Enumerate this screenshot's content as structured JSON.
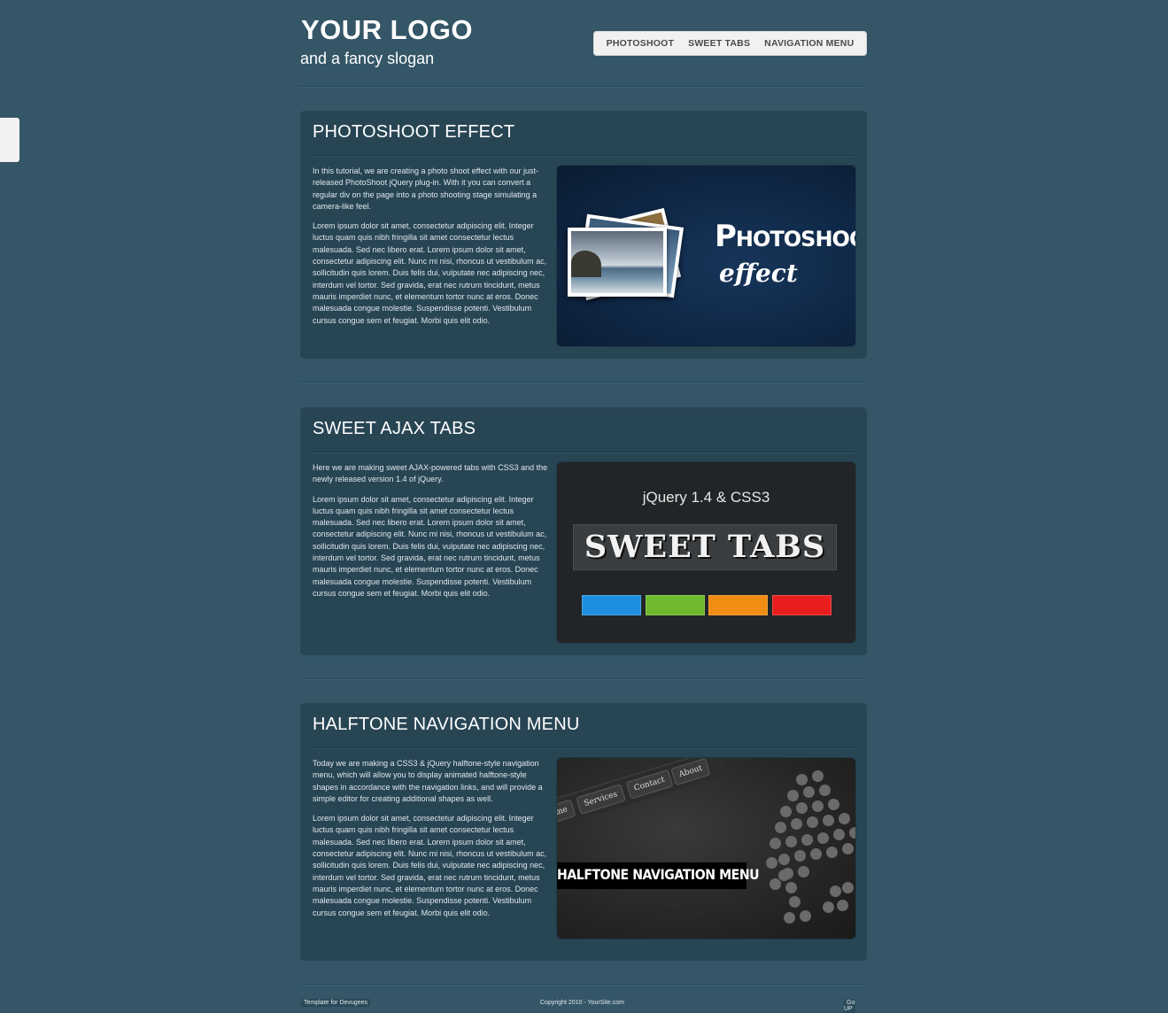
{
  "header": {
    "logo": "YOUR LOGO",
    "slogan": "and a fancy slogan"
  },
  "nav": {
    "items": [
      "PHOTOSHOOT",
      "SWEET TABS",
      "NAVIGATION MENU"
    ]
  },
  "sections": [
    {
      "title": "PHOTOSHOOT EFFECT",
      "intro": "In this tutorial, we are creating a photo shoot effect with our just-released PhotoShoot jQuery plug-in. With it you can convert a regular div on the page into a photo shooting stage simulating a camera-like feel.",
      "body": "Lorem ipsum dolor sit amet, consectetur adipiscing elit. Integer luctus quam quis nibh fringilla sit amet consectetur lectus malesuada. Sed nec libero erat. Lorem ipsum dolor sit amet, consectetur adipiscing elit. Nunc mi nisi, rhoncus ut vestibulum ac, sollicitudin quis lorem. Duis felis dui, vulputate nec adipiscing nec, interdum vel tortor. Sed gravida, erat nec rutrum tincidunt, metus mauris imperdiet nunc, et elementum tortor nunc at eros. Donec malesuada congue molestie. Suspendisse potenti. Vestibulum cursus congue sem et feugiat. Morbi quis elit odio.",
      "image": {
        "title": "Photoshoot",
        "subtitle": "effect"
      }
    },
    {
      "title": "SWEET AJAX TABS",
      "intro": "Here we are making sweet AJAX-powered tabs with CSS3 and the newly released version 1.4 of jQuery.",
      "body": "Lorem ipsum dolor sit amet, consectetur adipiscing elit. Integer luctus quam quis nibh fringilla sit amet consectetur lectus malesuada. Sed nec libero erat. Lorem ipsum dolor sit amet, consectetur adipiscing elit. Nunc mi nisi, rhoncus ut vestibulum ac, sollicitudin quis lorem. Duis felis dui, vulputate nec adipiscing nec, interdum vel tortor. Sed gravida, erat nec rutrum tincidunt, metus mauris imperdiet nunc, et elementum tortor nunc at eros. Donec malesuada congue molestie. Suspendisse potenti. Vestibulum cursus congue sem et feugiat. Morbi quis elit odio.",
      "image": {
        "caption": "jQuery 1.4 & CSS3",
        "title": "SWEET TABS",
        "swatches": [
          "#1e8fe0",
          "#6fba2c",
          "#f08d12",
          "#e81e1e"
        ]
      }
    },
    {
      "title": "HALFTONE NAVIGATION MENU",
      "intro": "Today we are making a CSS3 & jQuery halftone-style navigation menu, which will allow you to display animated halftone-style shapes in accordance with the navigation links, and will provide a simple editor for creating additional shapes as well.",
      "body": "Lorem ipsum dolor sit amet, consectetur adipiscing elit. Integer luctus quam quis nibh fringilla sit amet consectetur lectus malesuada. Sed nec libero erat. Lorem ipsum dolor sit amet, consectetur adipiscing elit. Nunc mi nisi, rhoncus ut vestibulum ac, sollicitudin quis lorem. Duis felis dui, vulputate nec adipiscing nec, interdum vel tortor. Sed gravida, erat nec rutrum tincidunt, metus mauris imperdiet nunc, et elementum tortor nunc at eros. Donec malesuada congue molestie. Suspendisse potenti. Vestibulum cursus congue sem et feugiat. Morbi quis elit odio.",
      "image": {
        "title": "HALFTONE NAVIGATION MENU",
        "menu": [
          "me",
          "Services",
          "Contact",
          "About"
        ]
      }
    }
  ],
  "footer": {
    "left": "Template for Devugees",
    "center": "Copyright 2010 - YourSite.com",
    "right": "Go UP"
  }
}
